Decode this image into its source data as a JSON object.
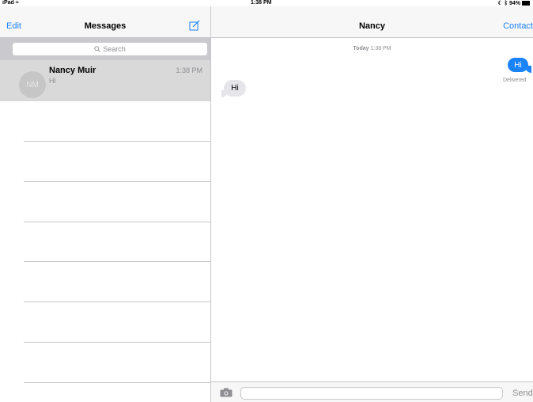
{
  "status_bar": {
    "device": "iPad",
    "time": "1:38 PM",
    "battery": "94%"
  },
  "sidebar": {
    "edit_label": "Edit",
    "title": "Messages",
    "compose_icon": "compose-icon",
    "search_placeholder": "Search",
    "conversations": [
      {
        "initials": "NM",
        "name": "Nancy Muir",
        "time": "1:38 PM",
        "preview": "Hi"
      }
    ]
  },
  "chat": {
    "title": "Nancy",
    "contact_label": "Contact",
    "timestamp_day": "Today",
    "timestamp_time": "1:38 PM",
    "messages": [
      {
        "direction": "outgoing",
        "text": "Hi"
      },
      {
        "direction": "incoming",
        "text": "Hi"
      }
    ],
    "delivered_label": "Delivered",
    "send_label": "Send"
  },
  "colors": {
    "accent": "#1a82fb",
    "outgoing_bubble": "#1a82fb",
    "incoming_bubble": "#e5e5ea",
    "selected_row": "#d9d9d9"
  }
}
